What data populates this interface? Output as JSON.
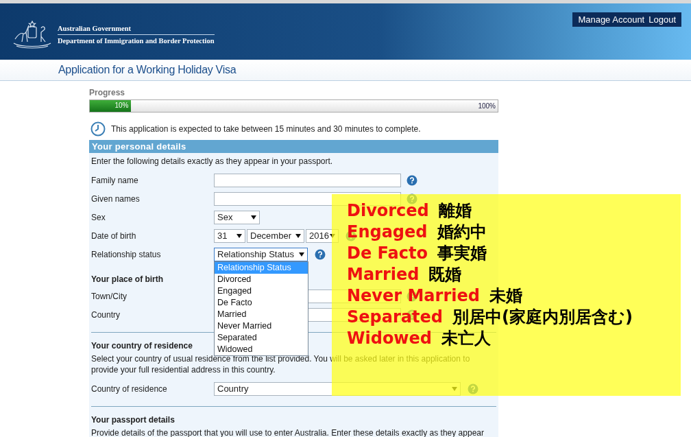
{
  "header": {
    "agency": "Australian Government",
    "department": "Department of Immigration and Border Protection",
    "links": [
      "Manage Account",
      "Logout"
    ]
  },
  "page_title": "Application for a Working Holiday Visa",
  "progress": {
    "label": "Progress",
    "level": 0.1,
    "reading": "10%",
    "end_label": "100%"
  },
  "notice": "This application is expected to take between 15 minutes and 30 minutes to complete.",
  "sections": [
    {
      "heading": "Your personal details",
      "kind": "banner",
      "intro": "Enter the following details exactly as they appear in your passport.",
      "fields": [
        {
          "kind": "text",
          "label": "Family name",
          "help": true
        },
        {
          "kind": "text",
          "label": "Given names",
          "help": true
        },
        {
          "kind": "select",
          "label": "Sex",
          "value": "Sex",
          "help": false
        },
        {
          "kind": "date",
          "label": "Date of birth",
          "parts": [
            "31",
            "December",
            "2016"
          ],
          "help": true
        },
        {
          "kind": "dropdown",
          "label": "Relationship status",
          "value": "Relationship Status",
          "help": true,
          "options": [
            {
              "label": "Relationship Status",
              "selected": true
            },
            {
              "label": "Divorced",
              "selected": false
            },
            {
              "label": "Engaged",
              "selected": false
            },
            {
              "label": "De Facto",
              "selected": false
            },
            {
              "label": "Married",
              "selected": false
            },
            {
              "label": "Never Married",
              "selected": false
            },
            {
              "label": "Separated",
              "selected": false
            },
            {
              "label": "Widowed",
              "selected": false
            }
          ]
        }
      ]
    },
    {
      "heading": "Your place of birth",
      "kind": "plain",
      "fields": [
        {
          "kind": "text",
          "label": "Town/City",
          "help": true
        },
        {
          "kind": "text",
          "label": "Country",
          "help": true
        }
      ]
    },
    {
      "heading": "Your country of residence",
      "kind": "plain",
      "intro": "Select your country of usual residence from the list provided. You will be asked later in this application to provide your full residential address in this country.",
      "fields": [
        {
          "kind": "wide-select",
          "label": "Country of residence",
          "value": "Country",
          "help": true
        }
      ]
    },
    {
      "heading": "Your passport details",
      "kind": "plain",
      "intro": "Provide details of the passport that you will use to enter Australia. Enter these details exactly as they appear"
    }
  ],
  "note": {
    "items": [
      {
        "en": "Divorced",
        "ja": "離婚"
      },
      {
        "en": "Engaged",
        "ja": "婚約中"
      },
      {
        "en": "De Facto",
        "ja": "事実婚"
      },
      {
        "en": "Married",
        "ja": "既婚"
      },
      {
        "en": "Never Married",
        "ja": "未婚"
      },
      {
        "en": "Separated",
        "ja": "別居中(家庭内別居含む)"
      },
      {
        "en": "Widowed",
        "ja": "未亡人"
      }
    ]
  }
}
